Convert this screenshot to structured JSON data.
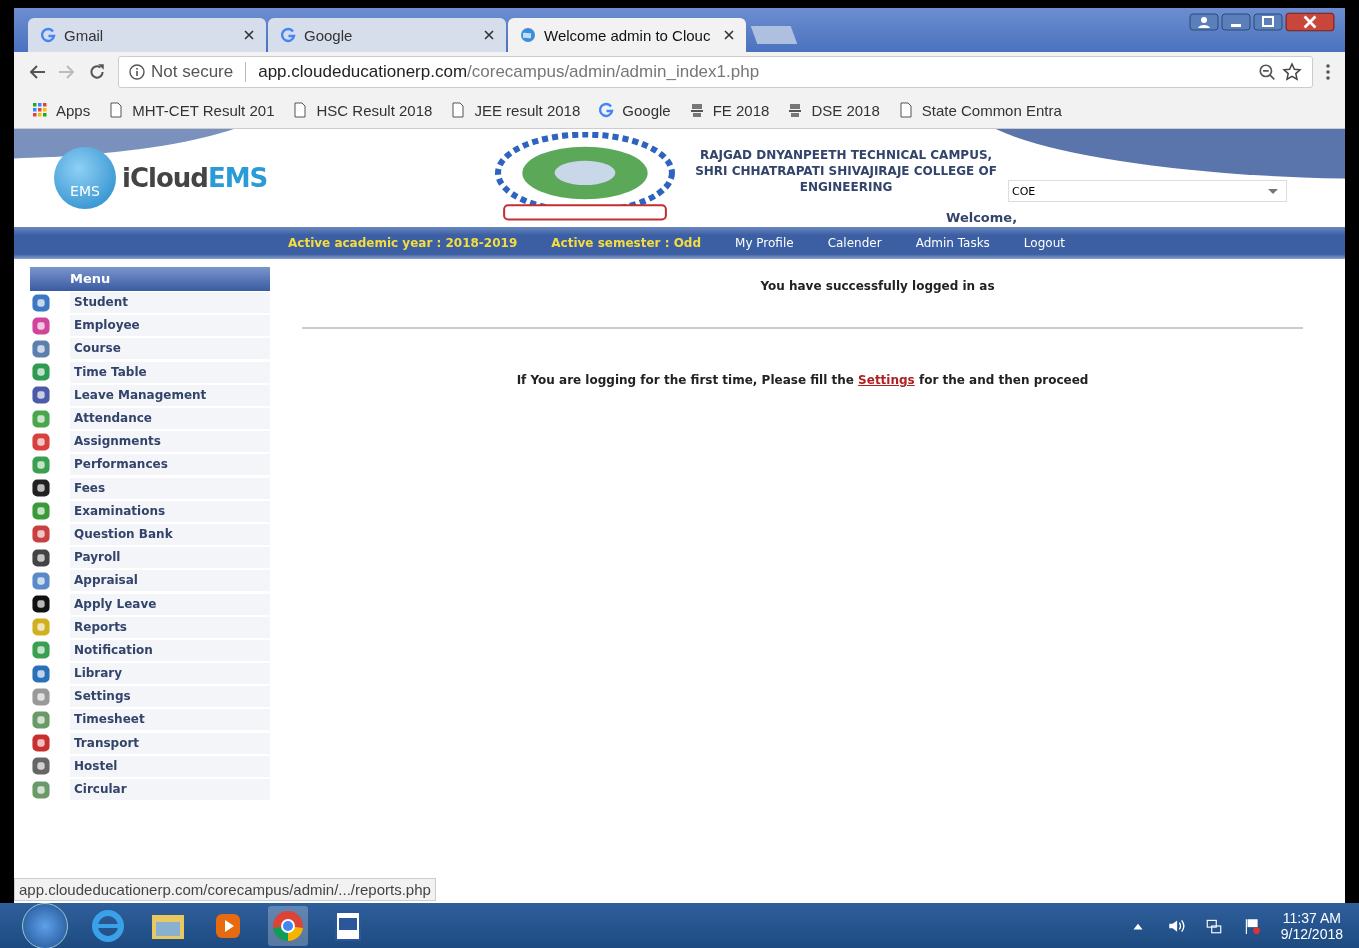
{
  "tabs": [
    {
      "title": "Gmail",
      "selected": false,
      "kind": "google"
    },
    {
      "title": "Google",
      "selected": false,
      "kind": "google"
    },
    {
      "title": "Welcome admin to Clouc",
      "selected": true,
      "kind": "globe"
    }
  ],
  "address_bar": {
    "security": "Not secure",
    "host": "app.cloudeducationerp.com",
    "path": "/corecampus/admin/admin_index1.php"
  },
  "bookmarks": [
    {
      "label": "Apps",
      "kind": "apps"
    },
    {
      "label": "MHT-CET Result 201",
      "kind": "page"
    },
    {
      "label": "HSC Result 2018",
      "kind": "page"
    },
    {
      "label": "JEE result 2018",
      "kind": "page"
    },
    {
      "label": "Google",
      "kind": "google"
    },
    {
      "label": "FE 2018",
      "kind": "emblem"
    },
    {
      "label": "DSE 2018",
      "kind": "emblem"
    },
    {
      "label": "State Common Entra",
      "kind": "page"
    }
  ],
  "header": {
    "logo_text_a": "iCloud",
    "logo_text_b": "EMS",
    "logo_badge": "EMS",
    "college_lines": [
      "RAJGAD DNYANPEETH TECHNICAL CAMPUS,",
      "SHRI CHHATRAPATI SHIVAJIRAJE COLLEGE OF",
      "ENGINEERING"
    ],
    "select_value": "COE",
    "welcome": "Welcome,"
  },
  "nav": {
    "info": [
      "Active academic year : 2018-2019",
      "Active semester : Odd"
    ],
    "links": [
      "My Profile",
      "Calender",
      "Admin Tasks",
      "Logout"
    ]
  },
  "menu": {
    "title": "Menu",
    "items": [
      "Student",
      "Employee",
      "Course",
      "Time Table",
      "Leave Management",
      "Attendance",
      "Assignments",
      "Performances",
      "Fees",
      "Examinations",
      "Question Bank",
      "Payroll",
      "Appraisal",
      "Apply Leave",
      "Reports",
      "Notification",
      "Library",
      "Settings",
      "Timesheet",
      "Transport",
      "Hostel",
      "Circular"
    ]
  },
  "main": {
    "login_message": "You have successfully logged in as",
    "notice_before": "If You are logging for the first time, Please fill the ",
    "notice_link": "Settings",
    "notice_after": " for the and then proceed"
  },
  "status_url": "app.cloudeducationerp.com/corecampus/admin/.../reports.php",
  "taskbar": {
    "time": "11:37 AM",
    "date": "9/12/2018"
  }
}
